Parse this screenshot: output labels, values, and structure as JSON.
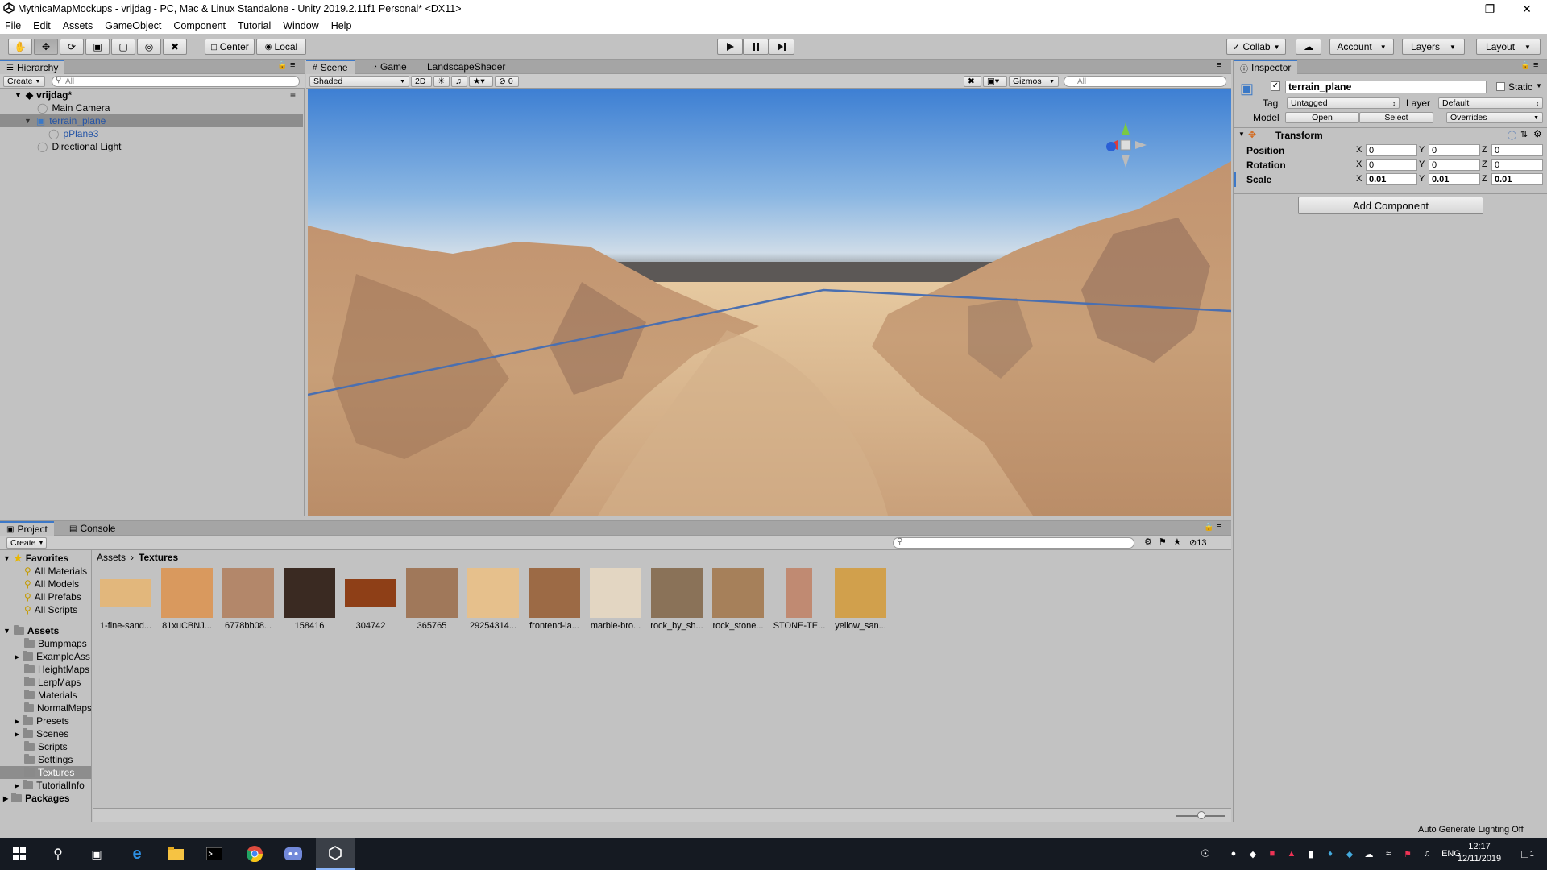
{
  "window": {
    "title": "MythicaMapMockups - vrijdag - PC, Mac & Linux Standalone - Unity 2019.2.11f1 Personal* <DX11>"
  },
  "menu": [
    "File",
    "Edit",
    "Assets",
    "GameObject",
    "Component",
    "Tutorial",
    "Window",
    "Help"
  ],
  "toolbar": {
    "pivot": "Center",
    "space": "Local",
    "collab": "Collab",
    "account": "Account",
    "layers": "Layers",
    "layout": "Layout"
  },
  "hierarchy": {
    "tab": "Hierarchy",
    "create": "Create",
    "search_placeholder": "All",
    "scene": "vrijdag*",
    "items": [
      {
        "label": "Main Camera"
      },
      {
        "label": "terrain_plane"
      },
      {
        "label": "pPlane3"
      },
      {
        "label": "Directional Light"
      }
    ]
  },
  "scene": {
    "tabs": [
      "Scene",
      "Game",
      "LandscapeShader"
    ],
    "shading": "Shaded",
    "mode2d": "2D",
    "hidden_count": "0",
    "gizmos": "Gizmos",
    "search_placeholder": "All"
  },
  "inspector": {
    "tab": "Inspector",
    "object_name": "terrain_plane",
    "static": "Static",
    "tag_label": "Tag",
    "tag": "Untagged",
    "layer_label": "Layer",
    "layer": "Default",
    "model_label": "Model",
    "open": "Open",
    "select": "Select",
    "overrides": "Overrides",
    "component": "Transform",
    "rows": [
      {
        "label": "Position",
        "x": "0",
        "y": "0",
        "z": "0"
      },
      {
        "label": "Rotation",
        "x": "0",
        "y": "0",
        "z": "0"
      },
      {
        "label": "Scale",
        "x": "0.01",
        "y": "0.01",
        "z": "0.01"
      }
    ],
    "axis_x": "X",
    "axis_y": "Y",
    "axis_z": "Z",
    "add_component": "Add Component"
  },
  "project": {
    "tabs": [
      "Project",
      "Console"
    ],
    "create": "Create",
    "count": "13",
    "breadcrumb_root": "Assets",
    "breadcrumb_current": "Textures",
    "favorites_label": "Favorites",
    "favorites": [
      "All Materials",
      "All Models",
      "All Prefabs",
      "All Scripts"
    ],
    "assets_label": "Assets",
    "folders": [
      "Bumpmaps",
      "ExampleAss",
      "HeightMaps",
      "LerpMaps",
      "Materials",
      "NormalMaps",
      "Presets",
      "Scenes",
      "Scripts",
      "Settings",
      "Textures",
      "TutorialInfo"
    ],
    "packages_label": "Packages",
    "assets": [
      {
        "name": "1-fine-sand...",
        "color": "#e2b77c"
      },
      {
        "name": "81xuCBNJ...",
        "color": "#d9995e"
      },
      {
        "name": "6778bb08...",
        "color": "#b3876a"
      },
      {
        "name": "158416",
        "color": "#3a2a22"
      },
      {
        "name": "304742",
        "color": "#8e3f17"
      },
      {
        "name": "365765",
        "color": "#a0785a"
      },
      {
        "name": "29254314...",
        "color": "#e6c08c"
      },
      {
        "name": "frontend-la...",
        "color": "#9c6a45"
      },
      {
        "name": "marble-bro...",
        "color": "#e3d6c2"
      },
      {
        "name": "rock_by_sh...",
        "color": "#8a7258"
      },
      {
        "name": "rock_stone...",
        "color": "#a6805a"
      },
      {
        "name": "STONE-TE...",
        "color": "#c08a72"
      },
      {
        "name": "yellow_san...",
        "color": "#d1a04c"
      }
    ]
  },
  "status": {
    "lighting": "Auto Generate Lighting Off"
  },
  "taskbar": {
    "lang": "ENG",
    "time": "12:17",
    "date": "12/11/2019",
    "notif": "1"
  }
}
